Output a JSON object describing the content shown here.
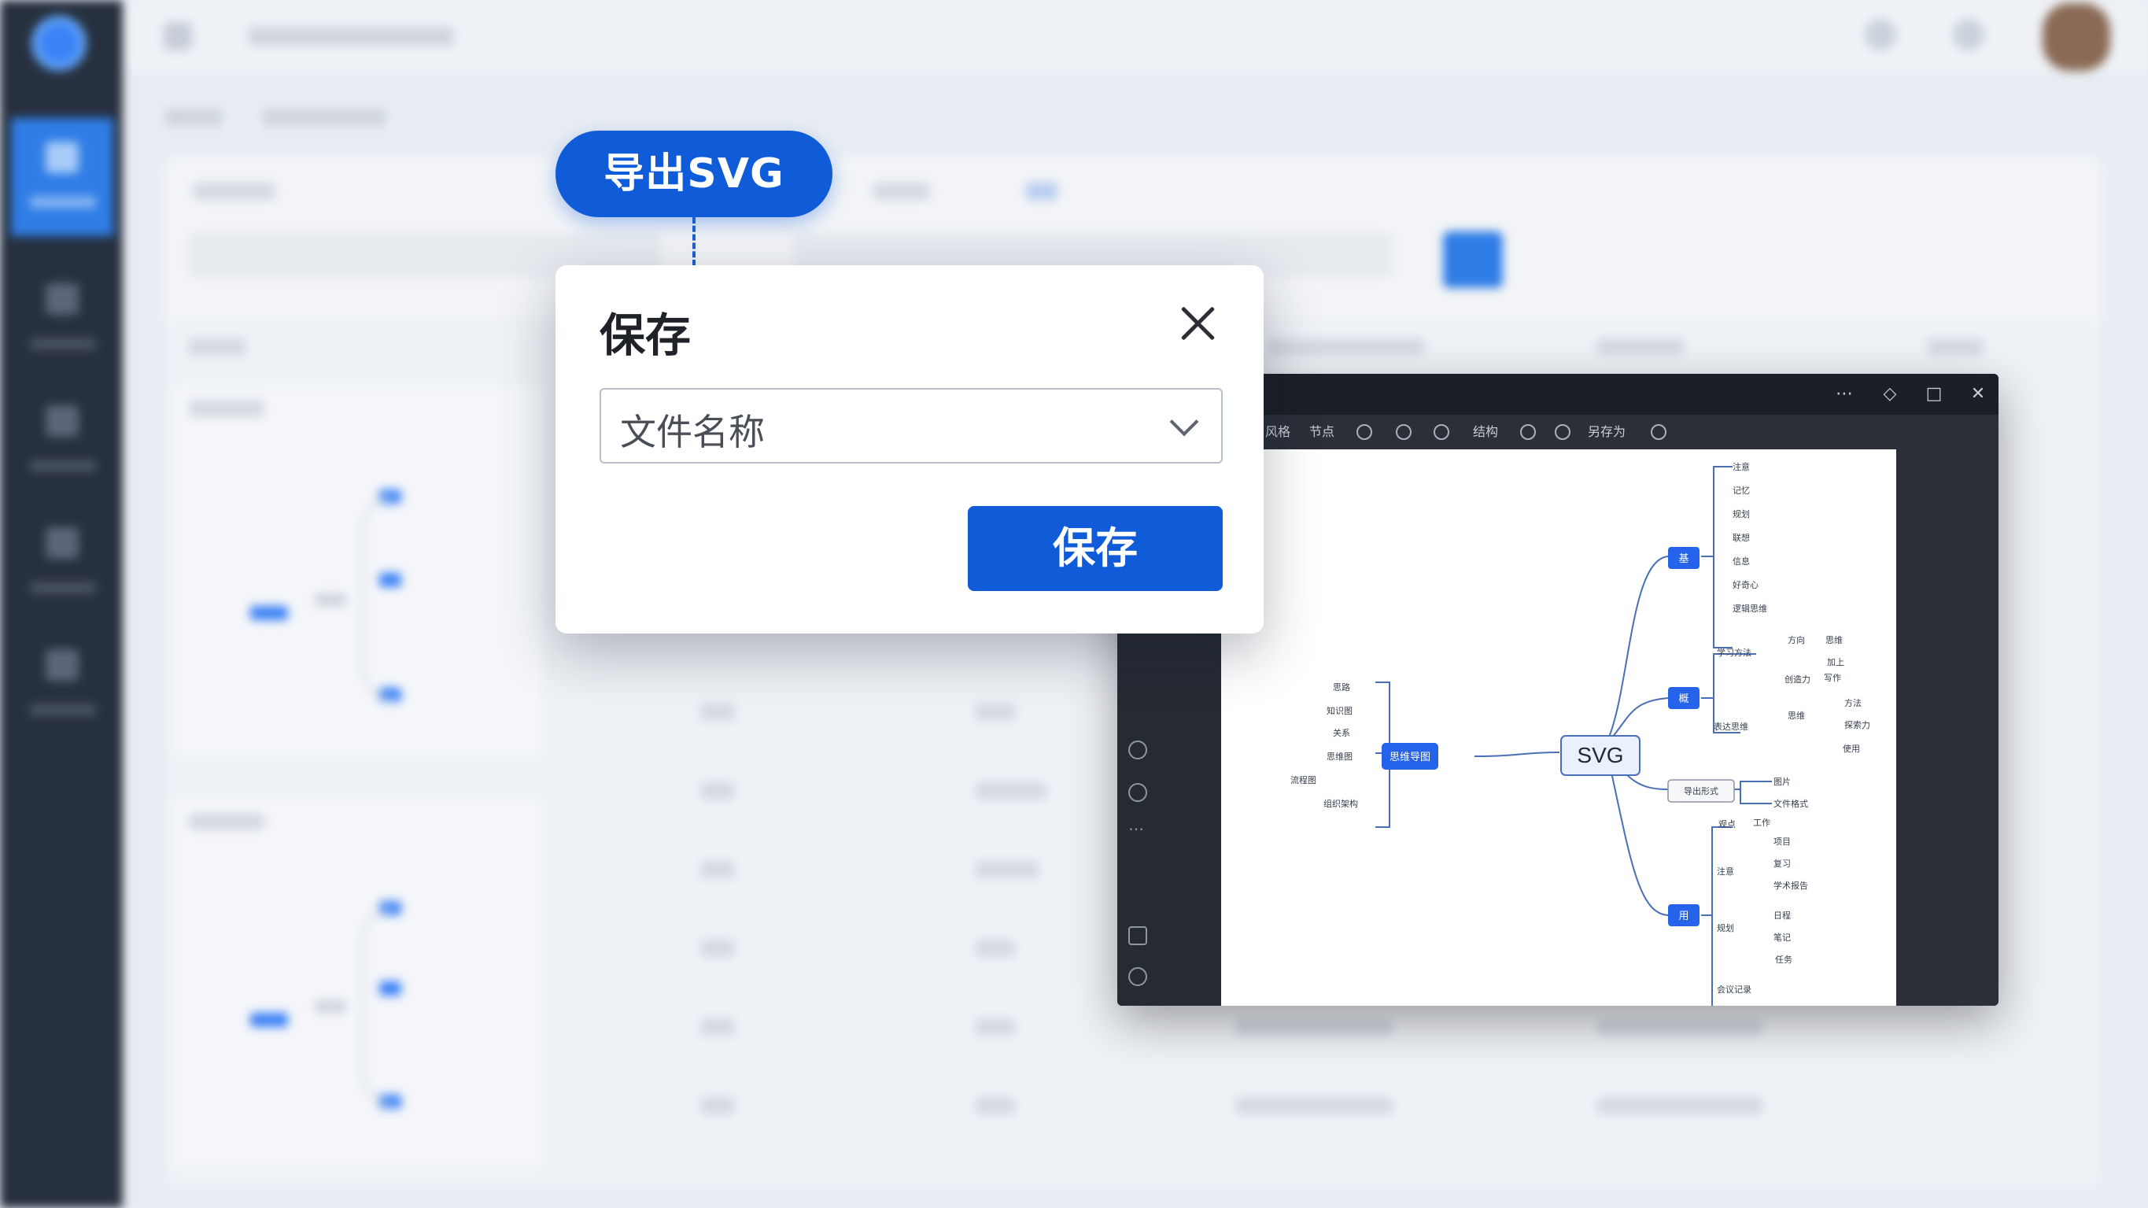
{
  "export_badge": {
    "label": "导出SVG"
  },
  "save_dialog": {
    "title": "保存",
    "filename_field": {
      "value": "文件名称"
    },
    "save_button": "保存"
  },
  "editor": {
    "toolbar": [
      "风格",
      "节点",
      "结构",
      "另存为"
    ],
    "root_label": "SVG",
    "left_branch": "思维导图",
    "left_leaves": [
      "思路",
      "知识图",
      "关系",
      "思维图",
      "流程图",
      "组织架构"
    ],
    "right_branches": [
      {
        "label": "基",
        "leaves": [
          "注意",
          "记忆",
          "规划",
          "联想",
          "信息",
          "好奇心",
          "逻辑思维"
        ]
      },
      {
        "label": "概",
        "leaves": [
          "学习方法",
          "表达思维",
          "方向",
          "思维",
          "创造力",
          "写作",
          "思维",
          "方法",
          "探索力",
          "加上",
          "使用"
        ]
      },
      {
        "label": "导出形式",
        "leaves": [
          "图片",
          "文件格式"
        ]
      },
      {
        "label": "用",
        "leaves": [
          "观点",
          "工作",
          "项目",
          "注意",
          "复习",
          "学术报告",
          "规划",
          "日程",
          "笔记",
          "任务",
          "会议记录"
        ]
      }
    ]
  },
  "colors": {
    "accent": "#0f5bd8",
    "sidebar": "#27303f",
    "node_blue": "#2563eb"
  }
}
